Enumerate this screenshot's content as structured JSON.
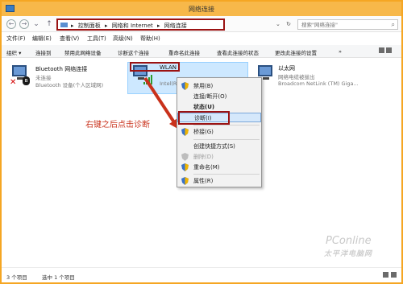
{
  "window": {
    "title": "网络连接"
  },
  "nav": {
    "back": "←",
    "forward": "→",
    "recent": "⌄",
    "up": "↑"
  },
  "address": {
    "sep": "▸",
    "crumbs": [
      "控制面板",
      "网络和 Internet",
      "网络连接"
    ],
    "dropdown": "⌄",
    "refresh": "↻"
  },
  "search": {
    "placeholder": "搜索\"网络连接\"",
    "icon": "search-icon"
  },
  "menu": [
    "文件(F)",
    "编辑(E)",
    "查看(V)",
    "工具(T)",
    "高级(N)",
    "帮助(H)"
  ],
  "commands": {
    "organize": "组织 ▾",
    "connect_to": "连接到",
    "disable": "禁用此网络设备",
    "diagnose": "诊断这个连接",
    "rename": "重命名此连接",
    "status": "查看此连接的状态",
    "change_settings": "更改此连接的设置",
    "more": "»"
  },
  "connections": {
    "bluetooth": {
      "name": "Bluetooth 网络连接",
      "status": "未连接",
      "device": "Bluetooth 设备(个人区域网)"
    },
    "wlan": {
      "name": "WLAN",
      "device": "Intel(R)"
    },
    "ethernet": {
      "name": "以太网",
      "status": "网络电缆被拔出",
      "device": "Broadcom NetLink (TM) Giga..."
    }
  },
  "annotation": "右键之后点击诊断",
  "context_menu": [
    {
      "label": "禁用(B)",
      "shield": true,
      "bold": false,
      "disabled": false
    },
    {
      "label": "连接/断开(O)",
      "shield": false,
      "bold": false,
      "disabled": false
    },
    {
      "label": "状态(U)",
      "shield": false,
      "bold": true,
      "disabled": false
    },
    {
      "label": "诊断(I)",
      "shield": false,
      "bold": false,
      "disabled": false,
      "highlighted": true
    },
    {
      "label": "桥接(G)",
      "shield": true,
      "bold": false,
      "disabled": false
    },
    {
      "label": "创建快捷方式(S)",
      "shield": false,
      "bold": false,
      "disabled": false
    },
    {
      "label": "删除(D)",
      "shield": true,
      "bold": false,
      "disabled": true
    },
    {
      "label": "重命名(M)",
      "shield": true,
      "bold": false,
      "disabled": false
    },
    {
      "label": "属性(R)",
      "shield": true,
      "bold": false,
      "disabled": false
    }
  ],
  "statusbar": {
    "count": "3 个项目",
    "selected": "选中 1 个项目"
  },
  "watermark": {
    "line1": "PConline",
    "line2": "太平洋电脑网"
  },
  "colors": {
    "titlebar": "#f7b84a",
    "highlight": "#cde8ff",
    "annotation": "#c9311b",
    "box": "#9b1313"
  }
}
